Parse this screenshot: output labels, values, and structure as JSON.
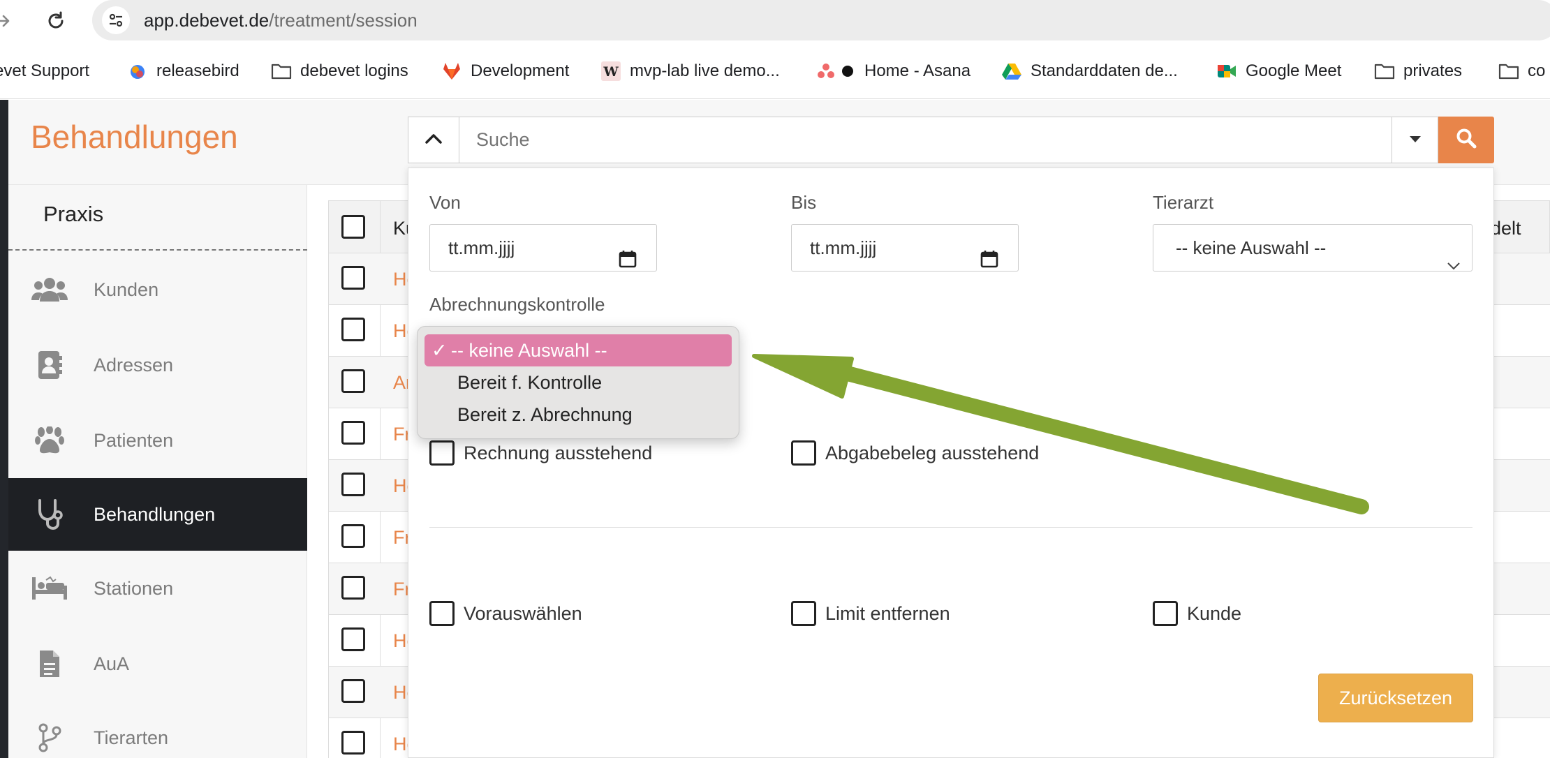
{
  "browser": {
    "url_host": "app.debevet.de",
    "url_path": "/treatment/session",
    "bookmarks": [
      {
        "label": "evet Support",
        "icon": "none"
      },
      {
        "label": "releasebird",
        "icon": "releasebird-icon"
      },
      {
        "label": "debevet logins",
        "icon": "folder-icon"
      },
      {
        "label": "Development",
        "icon": "gitlab-icon"
      },
      {
        "label": "mvp-lab live demo...",
        "icon": "w-icon"
      },
      {
        "label": "Home - Asana",
        "icon": "asana-icon"
      },
      {
        "label": "Standarddaten de...",
        "icon": "drive-icon"
      },
      {
        "label": "Google Meet",
        "icon": "meet-icon"
      },
      {
        "label": "privates",
        "icon": "folder-icon"
      },
      {
        "label": "co",
        "icon": "folder-icon"
      }
    ]
  },
  "app": {
    "title": "Behandlungen",
    "accent_color": "#e8854a",
    "sidebar": {
      "section": "Praxis",
      "items": [
        {
          "label": "Kunden",
          "icon": "users-icon",
          "active": false
        },
        {
          "label": "Adressen",
          "icon": "address-book-icon",
          "active": false
        },
        {
          "label": "Patienten",
          "icon": "paw-icon",
          "active": false
        },
        {
          "label": "Behandlungen",
          "icon": "stethoscope-icon",
          "active": true
        },
        {
          "label": "Stationen",
          "icon": "bed-icon",
          "active": false
        },
        {
          "label": "AuA",
          "icon": "file-icon",
          "active": false
        },
        {
          "label": "Tierarten",
          "icon": "branch-icon",
          "active": false
        }
      ]
    },
    "table": {
      "header_first": "Ku",
      "header_last": "delt",
      "row_prefixes": [
        "He",
        "He",
        "An",
        "Fr",
        "He",
        "Fr",
        "Fr",
        "He",
        "He",
        "He"
      ]
    },
    "search": {
      "placeholder": "Suche"
    },
    "filter": {
      "von_label": "Von",
      "von_placeholder": "tt.mm.jjjj",
      "bis_label": "Bis",
      "bis_placeholder": "tt.mm.jjjj",
      "tierarzt_label": "Tierarzt",
      "tierarzt_value": "-- keine Auswahl --",
      "abrechnung_label": "Abrechnungskontrolle",
      "abrechnung_options": [
        "-- keine Auswahl --",
        "Bereit f. Kontrolle",
        "Bereit z. Abrechnung"
      ],
      "abrechnung_selected": "-- keine Auswahl --",
      "rechnung_label": "Rechnung ausstehend",
      "abgabe_label": "Abgabebeleg ausstehend",
      "vorauswaehlen_label": "Vorauswählen",
      "limit_label": "Limit entfernen",
      "kunde_label": "Kunde",
      "reset_label": "Zurücksetzen"
    }
  },
  "annotation": {
    "arrow_color": "#84a532"
  }
}
